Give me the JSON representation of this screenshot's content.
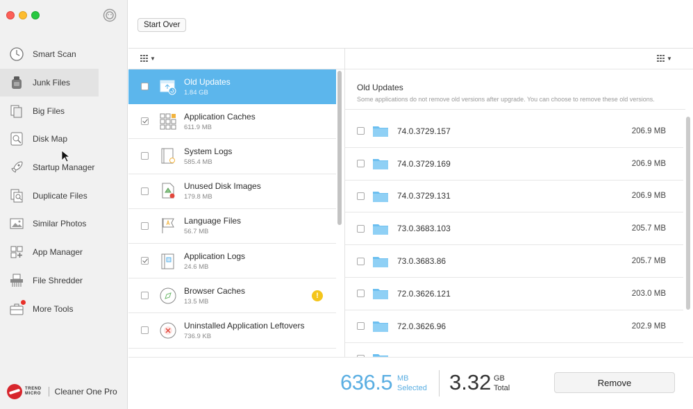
{
  "toolbar": {
    "start_over": "Start Over"
  },
  "sidebar": {
    "items": [
      {
        "label": "Smart Scan",
        "icon": "clock-scan-icon"
      },
      {
        "label": "Junk Files",
        "icon": "vacuum-icon",
        "active": true
      },
      {
        "label": "Big Files",
        "icon": "files-icon"
      },
      {
        "label": "Disk Map",
        "icon": "disk-map-icon"
      },
      {
        "label": "Startup Manager",
        "icon": "rocket-icon"
      },
      {
        "label": "Duplicate Files",
        "icon": "duplicate-icon"
      },
      {
        "label": "Similar Photos",
        "icon": "photo-icon"
      },
      {
        "label": "App Manager",
        "icon": "app-grid-icon"
      },
      {
        "label": "File Shredder",
        "icon": "shredder-icon"
      },
      {
        "label": "More Tools",
        "icon": "toolbox-icon",
        "badge": true
      }
    ],
    "brand_small_1": "TREND",
    "brand_small_2": "MICRO",
    "brand_name": "Cleaner One Pro"
  },
  "categories": [
    {
      "name": "Old Updates",
      "size": "1.84 GB",
      "checked": false,
      "selected": true
    },
    {
      "name": "Application Caches",
      "size": "611.9 MB",
      "checked": true
    },
    {
      "name": "System Logs",
      "size": "585.4 MB",
      "checked": false
    },
    {
      "name": "Unused Disk Images",
      "size": "179.8 MB",
      "checked": false
    },
    {
      "name": "Language Files",
      "size": "56.7 MB",
      "checked": false
    },
    {
      "name": "Application Logs",
      "size": "24.6 MB",
      "checked": true
    },
    {
      "name": "Browser Caches",
      "size": "13.5 MB",
      "checked": false,
      "warning": "!"
    },
    {
      "name": "Uninstalled Application Leftovers",
      "size": "736.9 KB",
      "checked": false
    }
  ],
  "detail": {
    "title": "Old Updates",
    "description": "Some applications do not remove old versions after upgrade. You can choose to remove these old versions.",
    "items": [
      {
        "name": "74.0.3729.157",
        "size": "206.9 MB"
      },
      {
        "name": "74.0.3729.169",
        "size": "206.9 MB"
      },
      {
        "name": "74.0.3729.131",
        "size": "206.9 MB"
      },
      {
        "name": "73.0.3683.103",
        "size": "205.7 MB"
      },
      {
        "name": "73.0.3683.86",
        "size": "205.7 MB"
      },
      {
        "name": "72.0.3626.121",
        "size": "203.0 MB"
      },
      {
        "name": "72.0.3626.96",
        "size": "202.9 MB"
      }
    ]
  },
  "footer": {
    "selected_value": "636.5",
    "selected_unit": "MB",
    "selected_label": "Selected",
    "total_value": "3.32",
    "total_unit": "GB",
    "total_label": "Total",
    "remove_label": "Remove"
  },
  "colors": {
    "accent": "#5cb6ec",
    "selected_text": "#5aaee2",
    "warning": "#f4c51c"
  }
}
